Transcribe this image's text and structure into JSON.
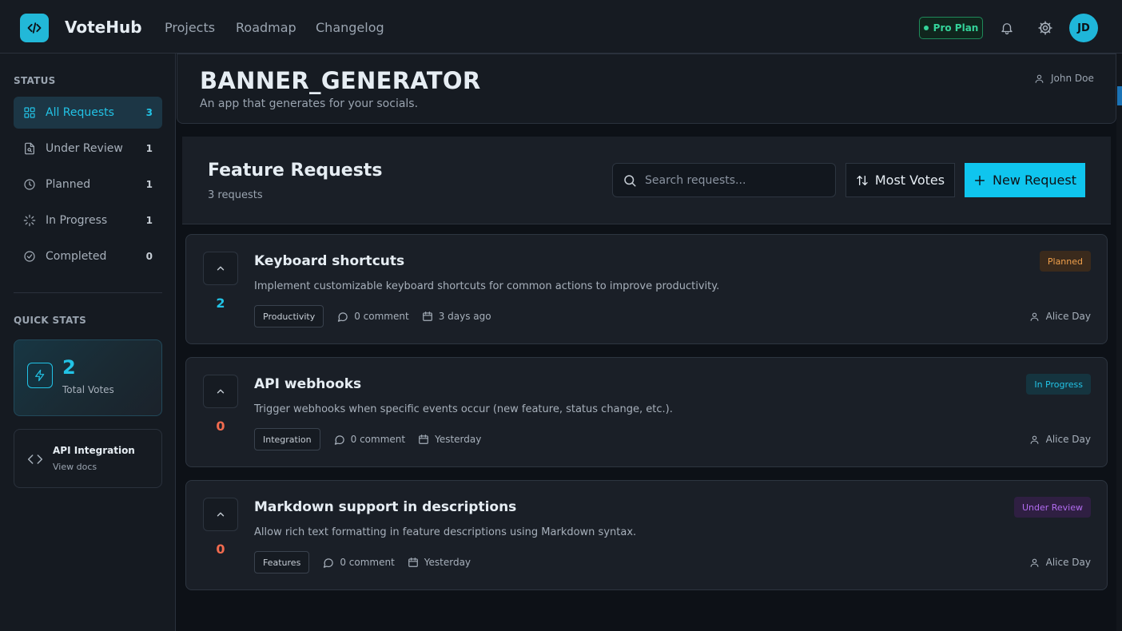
{
  "app": {
    "name": "VoteHub"
  },
  "nav": {
    "links": [
      "Projects",
      "Roadmap",
      "Changelog"
    ]
  },
  "header": {
    "plan_label": "Pro Plan",
    "avatar_initials": "JD"
  },
  "sidebar": {
    "status_heading": "STATUS",
    "items": [
      {
        "label": "All Requests",
        "count": "3"
      },
      {
        "label": "Under Review",
        "count": "1"
      },
      {
        "label": "Planned",
        "count": "1"
      },
      {
        "label": "In Progress",
        "count": "1"
      },
      {
        "label": "Completed",
        "count": "0"
      }
    ],
    "quick_stats_heading": "QUICK STATS",
    "total_votes": {
      "value": "2",
      "label": "Total Votes"
    },
    "api": {
      "title": "API Integration",
      "subtitle": "View docs"
    }
  },
  "project": {
    "title": "BANNER_GENERATOR",
    "description": "An app that generates for your socials.",
    "owner": "John Doe"
  },
  "feature_requests": {
    "title": "Feature Requests",
    "count_label": "3 requests",
    "search_placeholder": "Search requests...",
    "sort_label": "Most Votes",
    "new_label": "New Request"
  },
  "requests": [
    {
      "votes": "2",
      "title": "Keyboard shortcuts",
      "description": "Implement customizable keyboard shortcuts for common actions to improve productivity.",
      "tag": "Productivity",
      "comments": "0 comment",
      "date": "3 days ago",
      "status": "Planned",
      "author": "Alice Day"
    },
    {
      "votes": "0",
      "title": "API webhooks",
      "description": "Trigger webhooks when specific events occur (new feature, status change, etc.).",
      "tag": "Integration",
      "comments": "0 comment",
      "date": "Yesterday",
      "status": "In Progress",
      "author": "Alice Day"
    },
    {
      "votes": "0",
      "title": "Markdown support in descriptions",
      "description": "Allow rich text formatting in feature descriptions using Markdown syntax.",
      "tag": "Features",
      "comments": "0 comment",
      "date": "Yesterday",
      "status": "Under Review",
      "author": "Alice Day"
    }
  ],
  "colors": {
    "accent": "#22c3e6",
    "planned": "#f0a04b",
    "in_progress": "#22c3e6",
    "under_review": "#b26cf0",
    "vote_positive": "#22c3e6",
    "vote_zero": "#f26b4f"
  }
}
